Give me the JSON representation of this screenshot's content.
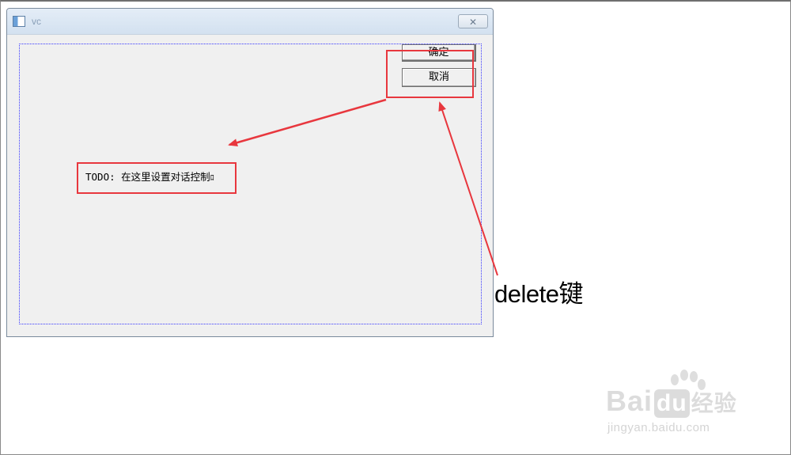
{
  "dialog": {
    "title": "vc",
    "close_glyph": "✕",
    "ok_label": "确定",
    "cancel_label": "取消",
    "todo_prefix": "TODO:",
    "todo_text": "在这里设置对话控制",
    "todo_suffix": "ﾛ"
  },
  "annotation": {
    "delete_key_text": "delete键",
    "highlight_color": "#e8373e"
  },
  "watermark": {
    "part1": "Bai",
    "part2": "du",
    "part3": "经验",
    "url": "jingyan.baidu.com"
  },
  "icons": {
    "app": "window-app-icon",
    "close": "close-icon",
    "paw": "baidu-paw-icon"
  }
}
